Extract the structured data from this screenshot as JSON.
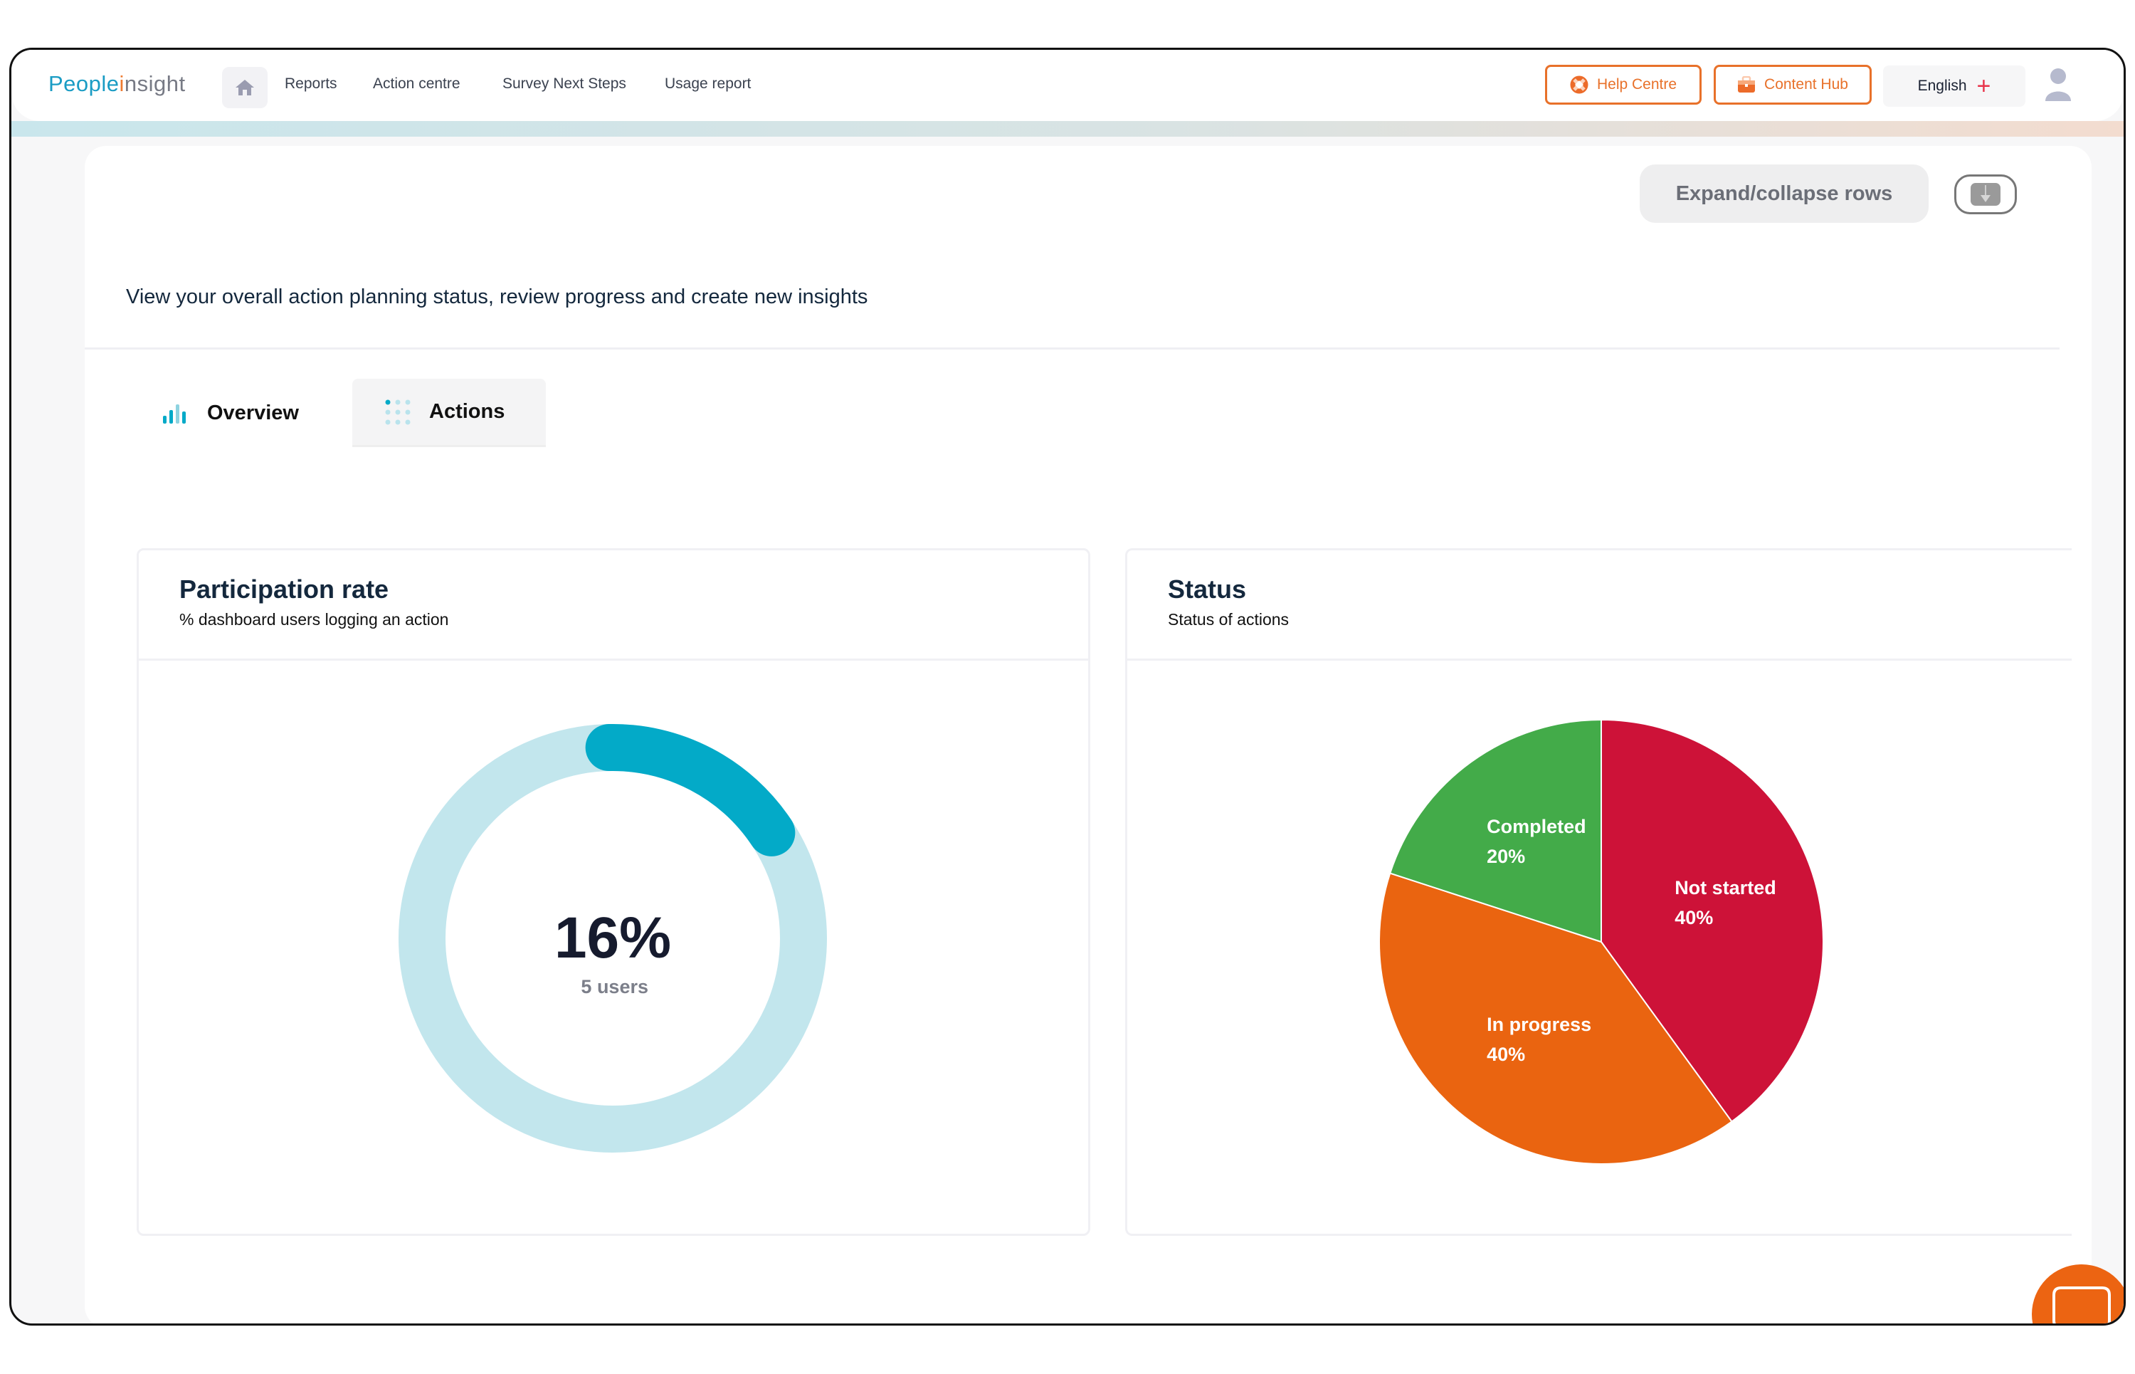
{
  "brand": {
    "part1": "People",
    "part2": "i",
    "part3": "nsight"
  },
  "nav": {
    "home_icon": "home-icon",
    "links": [
      "Reports",
      "Action centre",
      "Survey Next Steps",
      "Usage report"
    ]
  },
  "header_actions": {
    "help_centre": "Help Centre",
    "content_hub": "Content Hub",
    "language": "English",
    "language_icon": "plus-icon",
    "user_icon": "user-icon"
  },
  "toolbar": {
    "expand_collapse": "Expand/collapse rows",
    "download_icon": "download-icon"
  },
  "intro_text": "View your overall action planning status, review progress and create new insights",
  "tabs": [
    {
      "label": "Overview",
      "icon": "bar-chart-icon",
      "active": false
    },
    {
      "label": "Actions",
      "icon": "dots-grid-icon",
      "active": true
    }
  ],
  "colors": {
    "accent_orange": "#e8712a",
    "accent_teal": "#03aac8",
    "ring_track": "#c2e6ed",
    "chat_button": "#ec6412"
  },
  "chart_data": [
    {
      "type": "pie",
      "variant": "donut-gauge",
      "title": "Participation rate",
      "subtitle": "% dashboard users logging an action",
      "value": 16,
      "value_label": "16%",
      "secondary_label": "5 users",
      "max": 100
    },
    {
      "type": "pie",
      "title": "Status",
      "subtitle": "Status of actions",
      "categories": [
        "Not started",
        "In progress",
        "Completed"
      ],
      "values": [
        40,
        40,
        20
      ],
      "labels": [
        "40%",
        "40%",
        "20%"
      ],
      "colors": [
        "#cd1238",
        "#ea6410",
        "#43ab49"
      ]
    }
  ],
  "chat": {
    "icon": "chat-bubble-icon"
  }
}
